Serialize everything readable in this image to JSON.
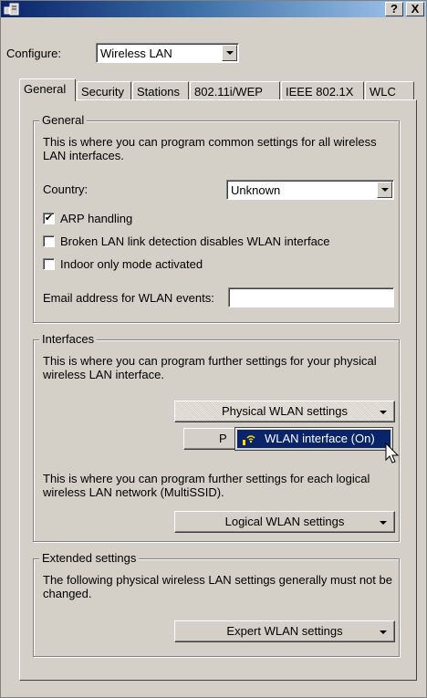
{
  "titlebar": {
    "help_label": "?",
    "close_label": "X"
  },
  "configure": {
    "label": "Configure:",
    "value": "Wireless LAN"
  },
  "tabs": [
    {
      "label": "General",
      "active": true
    },
    {
      "label": "Security"
    },
    {
      "label": "Stations"
    },
    {
      "label": "802.11i/WEP"
    },
    {
      "label": "IEEE 802.1X"
    },
    {
      "label": "WLC"
    }
  ],
  "general": {
    "title": "General",
    "description": "This is where you can program common settings for all wireless LAN interfaces.",
    "country_label": "Country:",
    "country_value": "Unknown",
    "arp": {
      "label": "ARP handling",
      "checked": true,
      "mark": "✔"
    },
    "broken_link": {
      "label": "Broken LAN link detection disables WLAN interface",
      "checked": false
    },
    "indoor": {
      "label": "Indoor only mode activated",
      "checked": false
    },
    "email_label": "Email address for WLAN events:",
    "email_value": ""
  },
  "interfaces": {
    "title": "Interfaces",
    "physical_description": "This is where you can program further settings for your physical wireless LAN interface.",
    "physical_button": "Physical WLAN settings",
    "second_button_visible": "P",
    "dropdown_item": "WLAN interface (On)",
    "dropdown_icon": "wlan-antenna-icon",
    "logical_description": "This is where you can program further settings for each logical wireless LAN network (MultiSSID).",
    "logical_button": "Logical WLAN settings"
  },
  "extended": {
    "title": "Extended settings",
    "description": "The following physical wireless LAN settings generally must not be changed.",
    "expert_button": "Expert WLAN settings"
  },
  "colors": {
    "titlebar_start": "#0a246a",
    "titlebar_end": "#a6caf0",
    "face": "#d4d0c8",
    "highlight": "#0a246a"
  }
}
